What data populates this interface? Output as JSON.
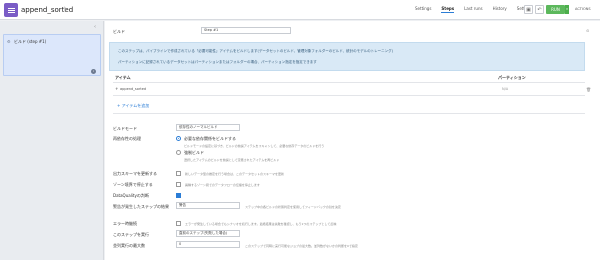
{
  "header": {
    "title": "append_sorted",
    "tabs": [
      "Settings",
      "Steps",
      "Last runs",
      "History",
      "Settings"
    ],
    "run_label": "RUN",
    "actions_label": "ACTIONS"
  },
  "left_panel": {
    "step_label": "ビルド (step #1)"
  },
  "build": {
    "label": "ビルド",
    "name_value": "Step #1",
    "info_line1": "このステップは、パイプラインで作成されている「必要可能性」アイテムをビルドします(データセットのビルド、管理対象フォルダーのビルド、統計のモデルのトレーニング)",
    "info_line2": "パーティションに記録されているデータセットはパーティションまたはフォルダーの場合、パーティション指定を指定できます"
  },
  "items_table": {
    "col_item": "アイテム",
    "col_partition": "パーティション",
    "rows": [
      {
        "name": "append_sorted",
        "partition": "N/A"
      }
    ],
    "add_label": "+ アイテムを追加"
  },
  "settings": {
    "build_mode_label": "ビルドモード",
    "build_mode_value": "依存性のノーマルビルド",
    "recompute_label": "再依存性の処理",
    "radio1": "必要な依存関係をビルドする",
    "radio1_note": "ビルドモードの設定に基づき、ビルドの前提アイテムをスキャンして、必要な依存データのビルドを行う",
    "radio2": "強制ビルド",
    "radio2_note": "選択したアイテムのビルドを前提として定義されたアイテムを再ビルド",
    "schema_label": "出力スキーマを更新する",
    "schema_note": "新しいデータ型の推定を行う場合は、このデータセットのスキーマを更新",
    "zone_label": "ゾーン境界で停止する",
    "zone_note": "異種するゾーン間でのデータフローの伝播を停止します",
    "dq_label": "DataQualityの判断",
    "fail_label": "警告が発生したステップの結果",
    "fail_value": "警告",
    "fail_note": "ステップ中の各ビルドの状態判定を使用してフィードバックの割を決定",
    "error_label": "エラー時継続",
    "error_note": "エラーが発生している場合でもシナリオを続行します。最終結果は失敗を確認し、もう1つのステップとして反映",
    "run_label": "このステップを実行",
    "run_value": "直前のステップ(失敗した場合)",
    "parallel_label": "並列実行の最大数",
    "parallel_value": "0",
    "parallel_note": "このステップで同時に実行可能なジョブの最大数。並列数がないかの判断を0で指定"
  }
}
